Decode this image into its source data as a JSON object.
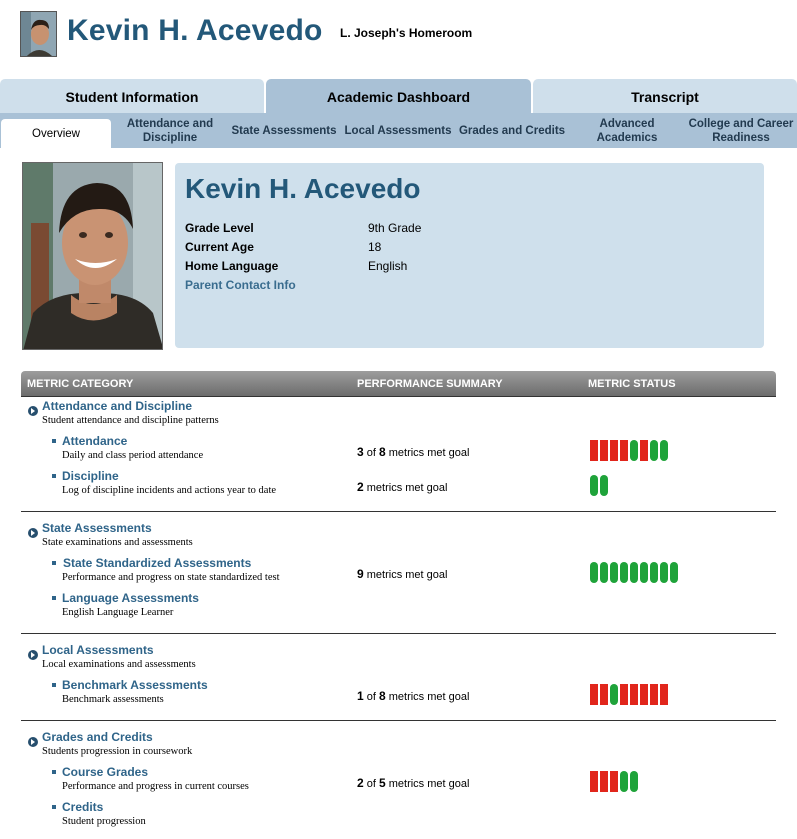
{
  "header": {
    "student_name": "Kevin H. Acevedo",
    "homeroom": "L. Joseph's Homeroom"
  },
  "tabs": [
    {
      "label": "Student Information",
      "active": false
    },
    {
      "label": "Academic Dashboard",
      "active": true
    },
    {
      "label": "Transcript",
      "active": false
    }
  ],
  "subtabs": [
    {
      "label": "Overview",
      "active": true
    },
    {
      "label": "Attendance and Discipline"
    },
    {
      "label": "State Assessments"
    },
    {
      "label": "Local Assessments"
    },
    {
      "label": "Grades and Credits"
    },
    {
      "label": "Advanced Academics"
    },
    {
      "label": "College and Career Readiness"
    }
  ],
  "profile": {
    "name": "Kevin H. Acevedo",
    "fields": [
      {
        "label": "Grade Level",
        "value": "9th Grade"
      },
      {
        "label": "Current Age",
        "value": "18"
      },
      {
        "label": "Home Language",
        "value": "English"
      }
    ],
    "contact_link": "Parent Contact Info"
  },
  "table": {
    "headers": [
      "METRIC CATEGORY",
      "PERFORMANCE SUMMARY",
      "METRIC STATUS"
    ],
    "colors": {
      "red": "#e1261c",
      "green": "#1fa33a"
    },
    "categories": [
      {
        "title": "Attendance and Discipline",
        "desc": "Student attendance and discipline patterns",
        "items": [
          {
            "title": "Attendance",
            "desc": "Daily and class period attendance",
            "summary": {
              "met": "3",
              "of": " of ",
              "total": "8",
              "text": " metrics met goal"
            },
            "status": [
              "red",
              "red",
              "red",
              "red",
              "green",
              "red",
              "green",
              "green"
            ]
          },
          {
            "title": "Discipline",
            "desc": "Log of discipline incidents and actions year to date",
            "summary": {
              "met": "2",
              "text": " metrics met goal"
            },
            "status": [
              "green",
              "green"
            ]
          }
        ]
      },
      {
        "title": "State Assessments",
        "desc": "State examinations and assessments",
        "items": [
          {
            "title": "State Standardized Assessments",
            "desc": "Performance and progress on state standardized test",
            "summary": {
              "met": "9",
              "text": " metrics met goal"
            },
            "status": [
              "green",
              "green",
              "green",
              "green",
              "green",
              "green",
              "green",
              "green",
              "green"
            ]
          },
          {
            "title": "Language Assessments",
            "desc": "English Language Learner"
          }
        ]
      },
      {
        "title": "Local Assessments",
        "desc": "Local examinations and assessments",
        "items": [
          {
            "title": "Benchmark Assessments",
            "desc": "Benchmark assessments",
            "summary": {
              "met": "1",
              "of": " of ",
              "total": "8",
              "text": " metrics met goal"
            },
            "status": [
              "red",
              "red",
              "green",
              "red",
              "red",
              "red",
              "red",
              "red"
            ]
          }
        ]
      },
      {
        "title": "Grades and Credits",
        "desc": "Students progression in coursework",
        "items": [
          {
            "title": "Course Grades",
            "desc": "Performance and progress in current courses",
            "summary": {
              "met": "2",
              "of": " of ",
              "total": "5",
              "text": " metrics met goal"
            },
            "status": [
              "red",
              "red",
              "red",
              "green",
              "green"
            ]
          },
          {
            "title": "Credits",
            "desc": "Student progression"
          }
        ]
      }
    ]
  }
}
